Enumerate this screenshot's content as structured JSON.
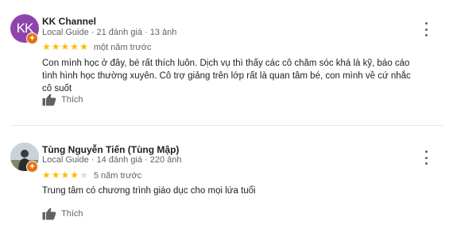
{
  "reviews": [
    {
      "avatar_initials": "KK",
      "avatar_color": "#8e44ad",
      "guide_badge_color": "#e8710a",
      "name": "KK Channel",
      "meta": "Local Guide · 21 đánh giá · 13 ảnh",
      "rating": 5,
      "date": "một năm trước",
      "text": "Con mình học ở đây, bé rất thích luôn. Dịch vụ thì thấy các cô chăm sóc khá là kỹ, báo cáo tình hình học thường xuyên. Cô trợ giảng trên lớp rất là quan tâm bé, con mình về cứ nhắc cô suốt",
      "like_label": "Thích",
      "like_icon": "thumbs-up-icon",
      "more_icon": "more-vertical-icon"
    },
    {
      "avatar_initials": "",
      "avatar_color": "#cfd6dc",
      "guide_badge_color": "#e8710a",
      "name": "Tùng Nguyễn Tiến (Tùng Mập)",
      "meta": "Local Guide · 14 đánh giá · 220 ảnh",
      "rating": 4,
      "date": "5 năm trước",
      "text": "Trung tâm có chương trình giáo dục cho mọi lứa tuổi",
      "like_label": "Thích",
      "like_icon": "thumbs-up-icon",
      "more_icon": "more-vertical-icon"
    }
  ],
  "star_color": "#fbbc04"
}
